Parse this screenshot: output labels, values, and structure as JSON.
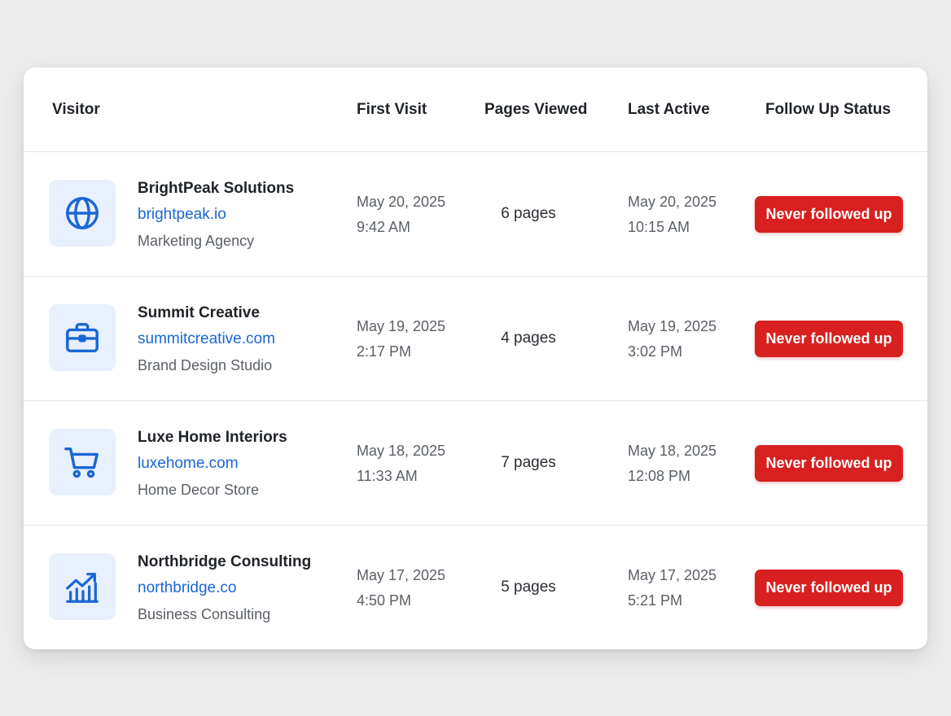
{
  "table": {
    "headers": {
      "visitor": "Visitor",
      "first_visit": "First Visit",
      "pages_viewed": "Pages Viewed",
      "last_active": "Last Active",
      "follow_up_status": "Follow Up Status"
    },
    "rows": [
      {
        "icon": "globe-icon",
        "company": "BrightPeak Solutions",
        "domain": "brightpeak.io",
        "category": "Marketing Agency",
        "first_visit_date": "May 20, 2025",
        "first_visit_time": "9:42 AM",
        "pages": "6 pages",
        "last_active_date": "May 20, 2025",
        "last_active_time": "10:15 AM",
        "status": "Never followed up"
      },
      {
        "icon": "briefcase-icon",
        "company": "Summit Creative",
        "domain": "summitcreative.com",
        "category": "Brand Design Studio",
        "first_visit_date": "May 19, 2025",
        "first_visit_time": "2:17 PM",
        "pages": "4 pages",
        "last_active_date": "May 19, 2025",
        "last_active_time": "3:02 PM",
        "status": "Never followed up"
      },
      {
        "icon": "shopping-cart-icon",
        "company": "Luxe Home Interiors",
        "domain": "luxehome.com",
        "category": "Home Decor Store",
        "first_visit_date": "May 18, 2025",
        "first_visit_time": "11:33 AM",
        "pages": "7 pages",
        "last_active_date": "May 18, 2025",
        "last_active_time": "12:08 PM",
        "status": "Never followed up"
      },
      {
        "icon": "growth-chart-icon",
        "company": "Northbridge Consulting",
        "domain": "northbridge.co",
        "category": "Business Consulting",
        "first_visit_date": "May 17, 2025",
        "first_visit_time": "4:50 PM",
        "pages": "5 pages",
        "last_active_date": "May 17, 2025",
        "last_active_time": "5:21 PM",
        "status": "Never followed up"
      }
    ]
  },
  "colors": {
    "page_background": "#ececec",
    "card_background": "#ffffff",
    "link": "#1a66d6",
    "icon": "#1a66d6",
    "icon_tile": "#e8f0fd",
    "status_badge": "#d92020"
  }
}
